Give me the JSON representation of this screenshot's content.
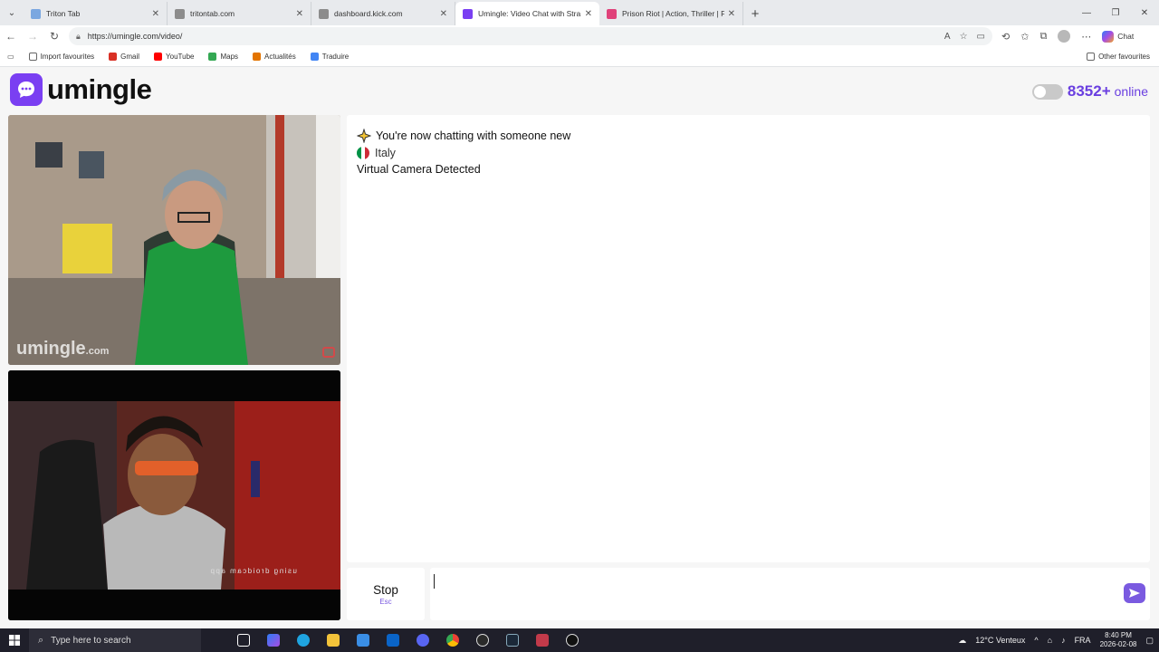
{
  "browser": {
    "tabs": [
      {
        "title": "Triton Tab",
        "favicon_color": "#7aa7e0",
        "active": false
      },
      {
        "title": "tritontab.com",
        "favicon_color": "#8c8c8c",
        "active": false
      },
      {
        "title": "dashboard.kick.com",
        "favicon_color": "#8c8c8c",
        "active": false
      },
      {
        "title": "Umingle: Video Chat with Stra",
        "favicon_color": "#7a3ff2",
        "active": true
      },
      {
        "title": "Prison Riot | Action, Thriller | Film C",
        "favicon_color": "#e0427a",
        "active": false
      }
    ],
    "url": "https://umingle.com/video/",
    "copilot_label": "Chat",
    "bookmarks": [
      {
        "label": "Import favourites",
        "icon": "import-icon",
        "color": "#666666"
      },
      {
        "label": "Gmail",
        "icon": "gmail-icon",
        "color": "#d93025"
      },
      {
        "label": "YouTube",
        "icon": "youtube-icon",
        "color": "#ff0000"
      },
      {
        "label": "Maps",
        "icon": "maps-icon",
        "color": "#34a853"
      },
      {
        "label": "Actualités",
        "icon": "news-icon",
        "color": "#e37400"
      },
      {
        "label": "Traduire",
        "icon": "translate-icon",
        "color": "#4285f4"
      }
    ],
    "other_favourites": "Other favourites"
  },
  "site": {
    "logo_text": "umingle",
    "brand_color": "#7a3ff2",
    "online_count": "8352+",
    "online_label": "online"
  },
  "videos": {
    "stranger_watermark_main": "umingle",
    "stranger_watermark_suffix": ".com",
    "self_overlay_text": "using droidcam app"
  },
  "chat": {
    "messages": [
      {
        "type": "system",
        "icon": "sparkle-icon",
        "text": "You're now chatting with someone new"
      },
      {
        "type": "country",
        "icon": "italy-flag-icon",
        "text": "Italy"
      },
      {
        "type": "notice",
        "text": "Virtual Camera Detected"
      }
    ]
  },
  "controls": {
    "stop_label": "Stop",
    "stop_shortcut": "Esc",
    "input_value": "",
    "send_icon": "send-icon"
  },
  "taskbar": {
    "search_placeholder": "Type here to search",
    "weather": "12°C  Venteux",
    "language": "FRA",
    "time": "8:40 PM",
    "date": "2026-02-08"
  }
}
